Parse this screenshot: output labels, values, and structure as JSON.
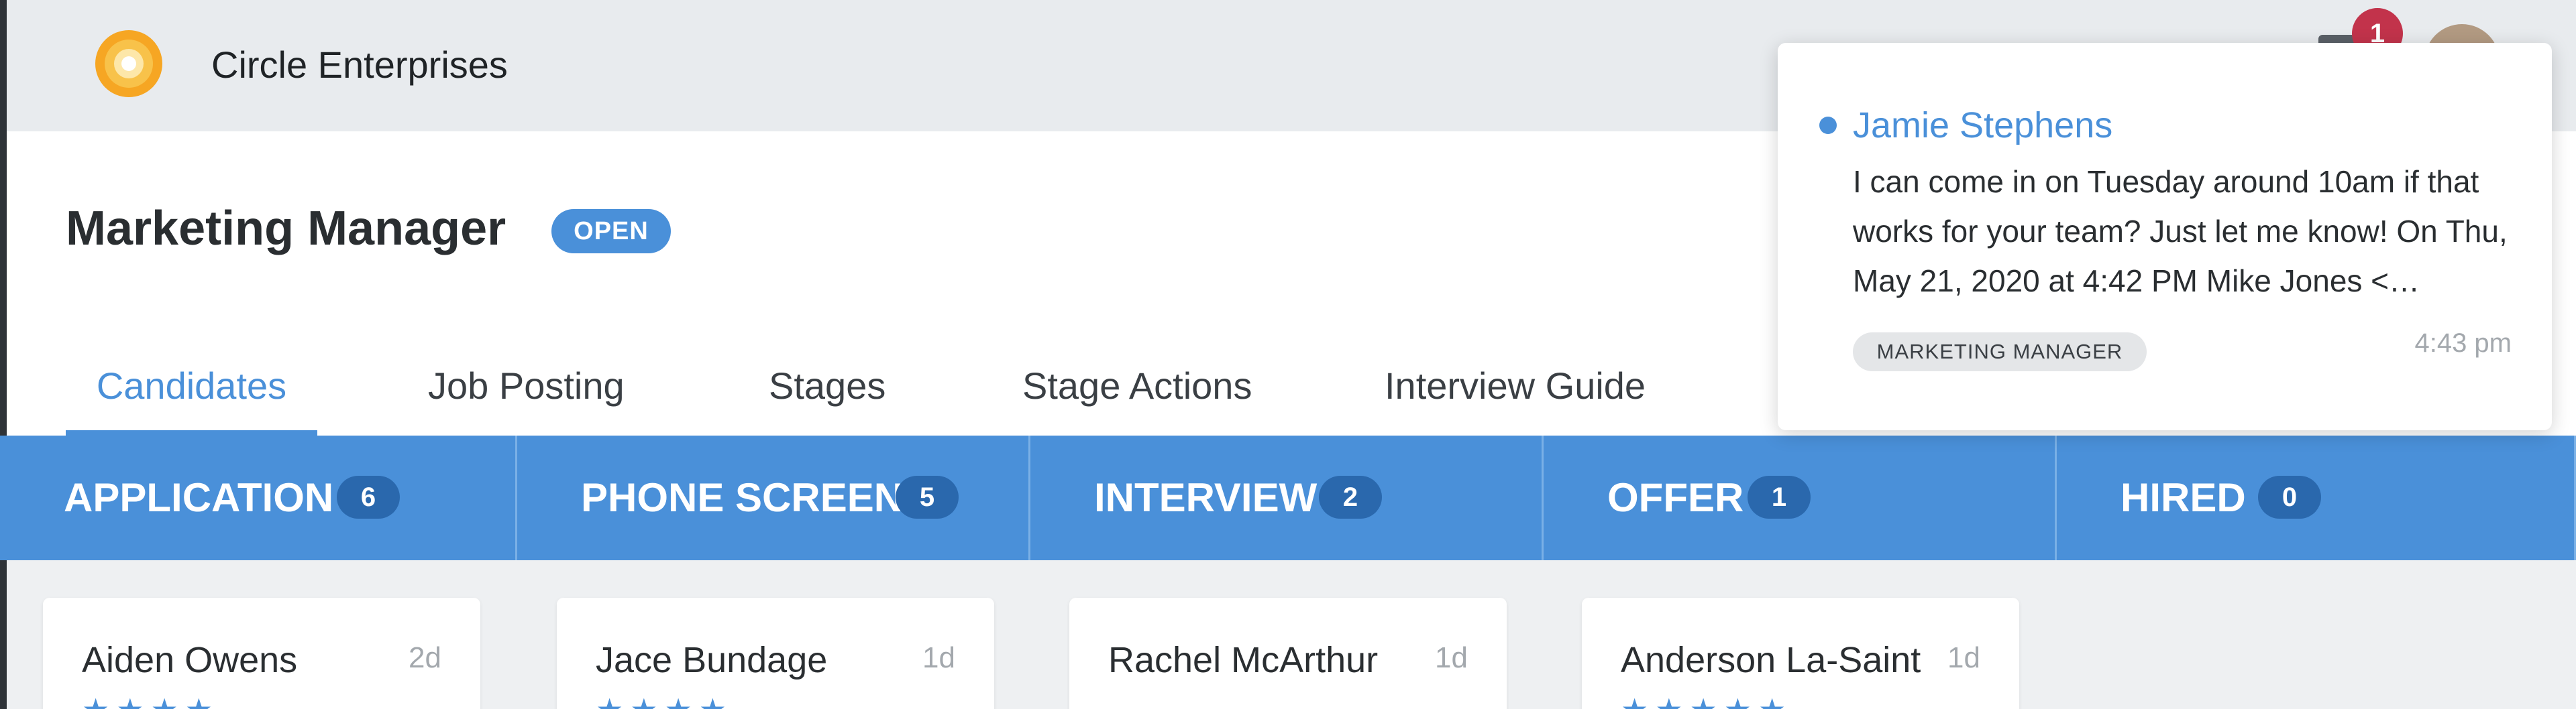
{
  "app": {
    "company_name": "Circle Enterprises",
    "logo_icon": "sun-circle-logo"
  },
  "job": {
    "title": "Marketing Manager",
    "status_badge": "OPEN"
  },
  "tabs": [
    {
      "label": "Candidates",
      "active": true
    },
    {
      "label": "Job Posting",
      "active": false
    },
    {
      "label": "Stages",
      "active": false
    },
    {
      "label": "Stage Actions",
      "active": false
    },
    {
      "label": "Interview Guide",
      "active": false
    }
  ],
  "stages": [
    {
      "name": "APPLICATION",
      "count": "6"
    },
    {
      "name": "PHONE SCREEN",
      "count": "5"
    },
    {
      "name": "INTERVIEW",
      "count": "2"
    },
    {
      "name": "OFFER",
      "count": "1"
    },
    {
      "name": "HIRED",
      "count": "0"
    }
  ],
  "cards": [
    {
      "name": "Aiden Owens",
      "age": "2d",
      "stars": "★★★★"
    },
    {
      "name": "Jace Bundage",
      "age": "1d",
      "stars": "★★★★"
    },
    {
      "name": "Rachel McArthur",
      "age": "1d",
      "stars": ""
    },
    {
      "name": "Anderson La-Saint",
      "age": "1d",
      "stars": "★★★★★"
    }
  ],
  "header_icons": {
    "notifications_icon": "mail-icon",
    "notifications_count": "1",
    "avatar": "user-avatar"
  },
  "notification": {
    "sender": "Jamie Stephens",
    "message": "I can come in on Tuesday around 10am if that works for your team?  Just let me know!  On Thu, May 21, 2020 at 4:42 PM Mike Jones <…",
    "tag": "MARKETING MANAGER",
    "time": "4:43 pm"
  },
  "colors": {
    "accent": "#4a90d9",
    "badge_dark": "#2a68ad",
    "alert": "#c2334b"
  }
}
